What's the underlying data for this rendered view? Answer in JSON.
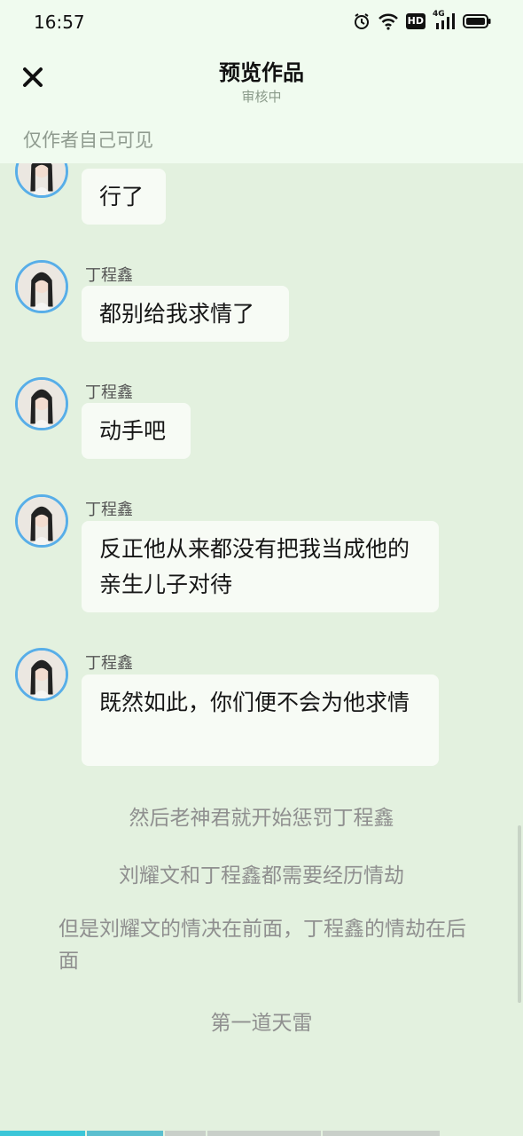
{
  "status_bar": {
    "time": "16:57",
    "network": "4G",
    "hd": "HD"
  },
  "header": {
    "title": "预览作品",
    "subtitle": "审核中",
    "close_icon": "close-icon"
  },
  "visibility_note": "仅作者自己可见",
  "messages": [
    {
      "sender": "",
      "text": "行了"
    },
    {
      "sender": "丁程鑫",
      "text": "都别给我求情了"
    },
    {
      "sender": "丁程鑫",
      "text": "动手吧"
    },
    {
      "sender": "丁程鑫",
      "text": "反正他从来都没有把我当成他的亲生儿子对待"
    },
    {
      "sender": "丁程鑫",
      "text": "既然如此，你们便不会为他求情"
    }
  ],
  "narrations": [
    "然后老神君就开始惩罚丁程鑫",
    "刘耀文和丁程鑫都需要经历情劫",
    "但是刘耀文的情决在前面，丁程鑫的情劫在后面",
    "第一道天雷"
  ],
  "colors": {
    "background": "#e3f1df",
    "header": "#f0fbef",
    "avatar_border": "#58aee8",
    "bubble": "#f7fbf5",
    "progress_active": "#3cc6d8",
    "progress_inactive": "#c9cfc9"
  }
}
